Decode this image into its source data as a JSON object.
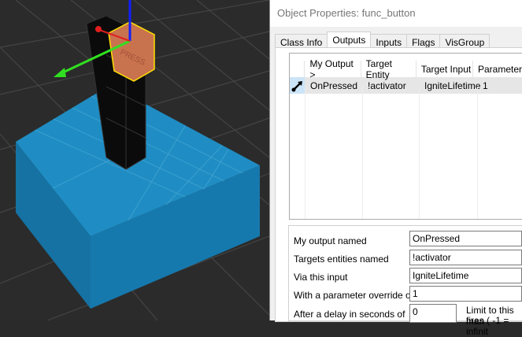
{
  "dialog": {
    "title": "Object Properties: func_button",
    "tabs": [
      "Class Info",
      "Outputs",
      "Inputs",
      "Flags",
      "VisGroup"
    ],
    "list": {
      "headers": [
        "My Output  >",
        "Target Entity",
        "Target Input",
        "Parameter"
      ],
      "rows": [
        {
          "output": "OnPressed",
          "target": "!activator",
          "input": "IgniteLifetime",
          "param": "1"
        }
      ]
    },
    "form": {
      "output_label": "My output named",
      "output_value": "OnPressed",
      "target_label": "Targets entities named",
      "target_value": "!activator",
      "input_label": "Via this input",
      "input_value": "IgniteLifetime",
      "param_label": "With a parameter override of",
      "param_value": "1",
      "delay_label": "After a delay in seconds of",
      "delay_value": "0",
      "limit_label": "Limit to this man",
      "limit_label2": "fires ( -1 = infinit"
    }
  },
  "viewport": {
    "button_text": "PRESS"
  }
}
